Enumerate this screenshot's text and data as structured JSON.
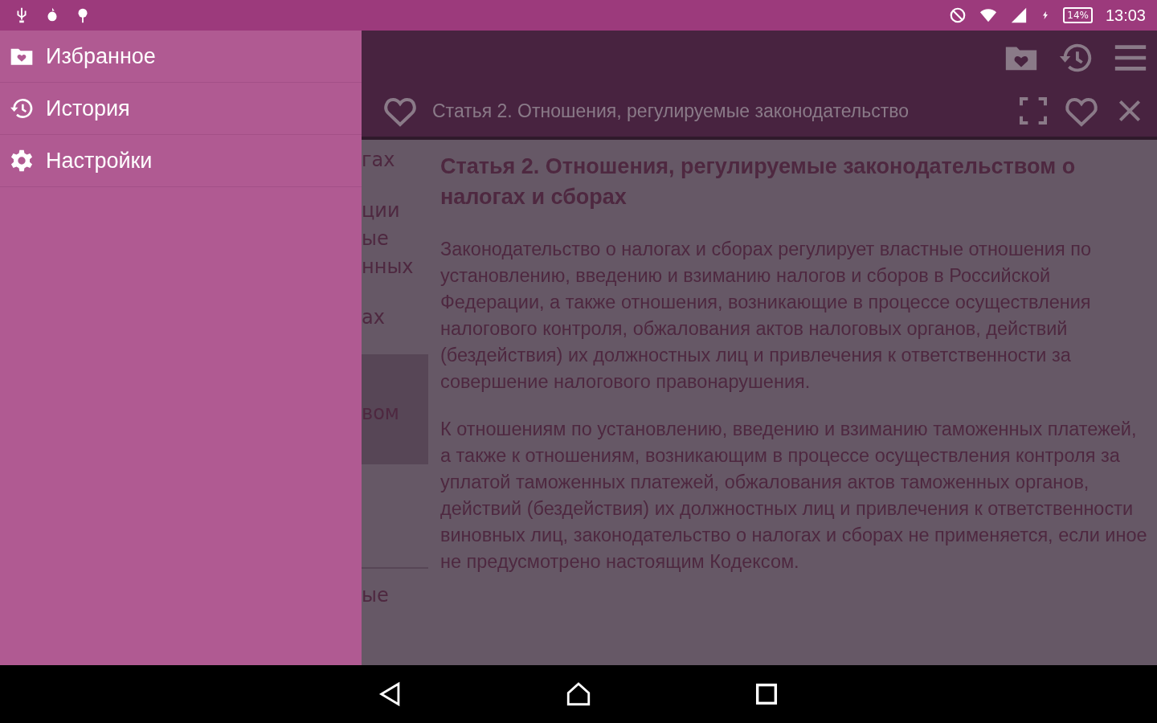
{
  "status_bar": {
    "battery": "14%",
    "time": "13:03"
  },
  "drawer": {
    "items": [
      {
        "kind": "favorites",
        "label": "Избранное"
      },
      {
        "kind": "history",
        "label": "История"
      },
      {
        "kind": "settings",
        "label": "Настройки"
      }
    ]
  },
  "tab": {
    "title": "Статья 2. Отношения, регулируемые законодательство"
  },
  "list": [
    {
      "lines": [
        "гах"
      ],
      "selected": false
    },
    {
      "lines": [
        "ции",
        "ые",
        "нных"
      ],
      "selected": false
    },
    {
      "lines": [
        "ах"
      ],
      "selected": false
    },
    {
      "lines": [
        "вом"
      ],
      "selected": true
    },
    {
      "lines": [
        "ые"
      ],
      "selected": false
    }
  ],
  "article": {
    "heading": "Статья 2. Отношения, регулируемые законодательством о налогах и сборах",
    "paragraphs": [
      "Законодательство о налогах и сборах регулирует властные отношения по установлению, введению и взиманию налогов и сборов в Российской Федерации, а также отношения, возникающие в процессе осуществления налогового контроля, обжалования актов налоговых органов, действий (бездействия) их должностных лиц и привлечения к ответственности за совершение налогового правонарушения.",
      "К отношениям по установлению, введению и взиманию таможенных платежей, а также к отношениям, возникающим в процессе осуществления контроля за уплатой таможенных платежей, обжалования актов таможенных органов, действий (бездействия) их должностных лиц и привлечения к ответственности виновных лиц, законодательство о налогах и сборах не применяется, если иное не предусмотрено настоящим Кодексом."
    ]
  }
}
